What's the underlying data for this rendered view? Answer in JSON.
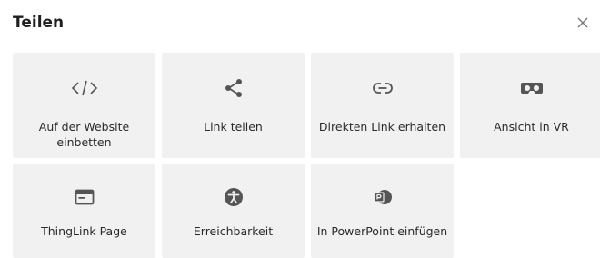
{
  "dialog": {
    "title": "Teilen",
    "close_icon": "close-icon"
  },
  "tiles": [
    {
      "label": "Auf der Website einbetten",
      "icon": "code-icon"
    },
    {
      "label": "Link teilen",
      "icon": "share-icon"
    },
    {
      "label": "Direkten Link erhalten",
      "icon": "link-icon"
    },
    {
      "label": "Ansicht in VR",
      "icon": "vr-headset-icon"
    },
    {
      "label": "ThingLink Page",
      "icon": "page-icon"
    },
    {
      "label": "Erreichbarkeit",
      "icon": "accessibility-icon"
    },
    {
      "label": "In PowerPoint einfügen",
      "icon": "powerpoint-icon"
    }
  ],
  "colors": {
    "tile_bg": "#f1f1f1",
    "icon": "#555555",
    "title": "#1f1f1f"
  }
}
